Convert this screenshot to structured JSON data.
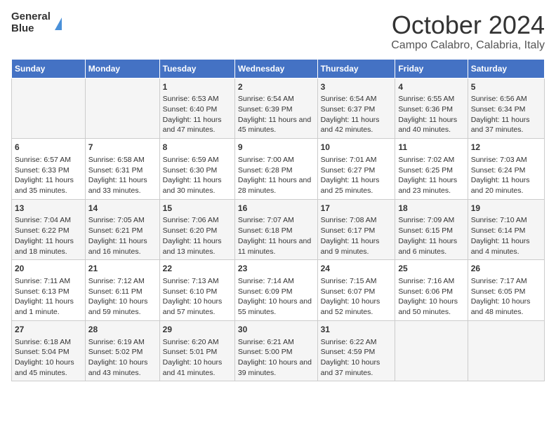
{
  "logo": {
    "line1": "General",
    "line2": "Blue"
  },
  "title": "October 2024",
  "subtitle": "Campo Calabro, Calabria, Italy",
  "headers": [
    "Sunday",
    "Monday",
    "Tuesday",
    "Wednesday",
    "Thursday",
    "Friday",
    "Saturday"
  ],
  "weeks": [
    [
      {
        "day": "",
        "content": ""
      },
      {
        "day": "",
        "content": ""
      },
      {
        "day": "1",
        "content": "Sunrise: 6:53 AM\nSunset: 6:40 PM\nDaylight: 11 hours and 47 minutes."
      },
      {
        "day": "2",
        "content": "Sunrise: 6:54 AM\nSunset: 6:39 PM\nDaylight: 11 hours and 45 minutes."
      },
      {
        "day": "3",
        "content": "Sunrise: 6:54 AM\nSunset: 6:37 PM\nDaylight: 11 hours and 42 minutes."
      },
      {
        "day": "4",
        "content": "Sunrise: 6:55 AM\nSunset: 6:36 PM\nDaylight: 11 hours and 40 minutes."
      },
      {
        "day": "5",
        "content": "Sunrise: 6:56 AM\nSunset: 6:34 PM\nDaylight: 11 hours and 37 minutes."
      }
    ],
    [
      {
        "day": "6",
        "content": "Sunrise: 6:57 AM\nSunset: 6:33 PM\nDaylight: 11 hours and 35 minutes."
      },
      {
        "day": "7",
        "content": "Sunrise: 6:58 AM\nSunset: 6:31 PM\nDaylight: 11 hours and 33 minutes."
      },
      {
        "day": "8",
        "content": "Sunrise: 6:59 AM\nSunset: 6:30 PM\nDaylight: 11 hours and 30 minutes."
      },
      {
        "day": "9",
        "content": "Sunrise: 7:00 AM\nSunset: 6:28 PM\nDaylight: 11 hours and 28 minutes."
      },
      {
        "day": "10",
        "content": "Sunrise: 7:01 AM\nSunset: 6:27 PM\nDaylight: 11 hours and 25 minutes."
      },
      {
        "day": "11",
        "content": "Sunrise: 7:02 AM\nSunset: 6:25 PM\nDaylight: 11 hours and 23 minutes."
      },
      {
        "day": "12",
        "content": "Sunrise: 7:03 AM\nSunset: 6:24 PM\nDaylight: 11 hours and 20 minutes."
      }
    ],
    [
      {
        "day": "13",
        "content": "Sunrise: 7:04 AM\nSunset: 6:22 PM\nDaylight: 11 hours and 18 minutes."
      },
      {
        "day": "14",
        "content": "Sunrise: 7:05 AM\nSunset: 6:21 PM\nDaylight: 11 hours and 16 minutes."
      },
      {
        "day": "15",
        "content": "Sunrise: 7:06 AM\nSunset: 6:20 PM\nDaylight: 11 hours and 13 minutes."
      },
      {
        "day": "16",
        "content": "Sunrise: 7:07 AM\nSunset: 6:18 PM\nDaylight: 11 hours and 11 minutes."
      },
      {
        "day": "17",
        "content": "Sunrise: 7:08 AM\nSunset: 6:17 PM\nDaylight: 11 hours and 9 minutes."
      },
      {
        "day": "18",
        "content": "Sunrise: 7:09 AM\nSunset: 6:15 PM\nDaylight: 11 hours and 6 minutes."
      },
      {
        "day": "19",
        "content": "Sunrise: 7:10 AM\nSunset: 6:14 PM\nDaylight: 11 hours and 4 minutes."
      }
    ],
    [
      {
        "day": "20",
        "content": "Sunrise: 7:11 AM\nSunset: 6:13 PM\nDaylight: 11 hours and 1 minute."
      },
      {
        "day": "21",
        "content": "Sunrise: 7:12 AM\nSunset: 6:11 PM\nDaylight: 10 hours and 59 minutes."
      },
      {
        "day": "22",
        "content": "Sunrise: 7:13 AM\nSunset: 6:10 PM\nDaylight: 10 hours and 57 minutes."
      },
      {
        "day": "23",
        "content": "Sunrise: 7:14 AM\nSunset: 6:09 PM\nDaylight: 10 hours and 55 minutes."
      },
      {
        "day": "24",
        "content": "Sunrise: 7:15 AM\nSunset: 6:07 PM\nDaylight: 10 hours and 52 minutes."
      },
      {
        "day": "25",
        "content": "Sunrise: 7:16 AM\nSunset: 6:06 PM\nDaylight: 10 hours and 50 minutes."
      },
      {
        "day": "26",
        "content": "Sunrise: 7:17 AM\nSunset: 6:05 PM\nDaylight: 10 hours and 48 minutes."
      }
    ],
    [
      {
        "day": "27",
        "content": "Sunrise: 6:18 AM\nSunset: 5:04 PM\nDaylight: 10 hours and 45 minutes."
      },
      {
        "day": "28",
        "content": "Sunrise: 6:19 AM\nSunset: 5:02 PM\nDaylight: 10 hours and 43 minutes."
      },
      {
        "day": "29",
        "content": "Sunrise: 6:20 AM\nSunset: 5:01 PM\nDaylight: 10 hours and 41 minutes."
      },
      {
        "day": "30",
        "content": "Sunrise: 6:21 AM\nSunset: 5:00 PM\nDaylight: 10 hours and 39 minutes."
      },
      {
        "day": "31",
        "content": "Sunrise: 6:22 AM\nSunset: 4:59 PM\nDaylight: 10 hours and 37 minutes."
      },
      {
        "day": "",
        "content": ""
      },
      {
        "day": "",
        "content": ""
      }
    ]
  ]
}
